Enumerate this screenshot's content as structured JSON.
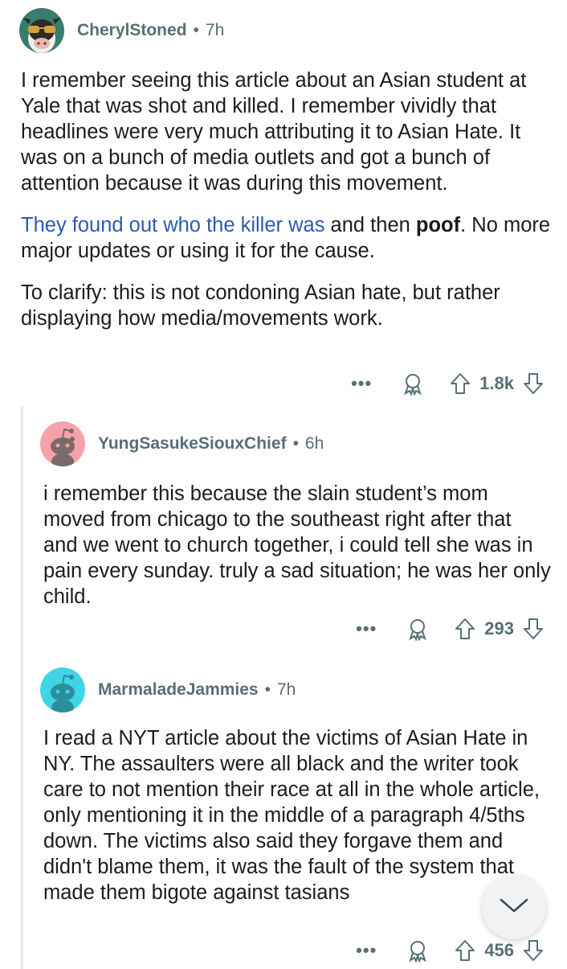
{
  "comments": [
    {
      "username": "CherylStoned",
      "time": "7h",
      "avatar_icon": "cow-sunglasses-avatar",
      "para1": "I remember seeing this article about an Asian student at Yale that was shot and killed. I remember vividly that headlines were very much attributing it to Asian Hate. It was on a bunch of media outlets and got a bunch of attention because it was during this movement.",
      "para2_link": "They found out who the killer was",
      "para2_mid": " and then ",
      "para2_bold": "poof",
      "para2_end": ". No more major updates or using it for the cause.",
      "para3": "To clarify: this is not condoning Asian hate, but rather displaying how media/movements work.",
      "score": "1.8k"
    },
    {
      "username": "YungSasukeSiouxChief",
      "time": "6h",
      "avatar_icon": "snoo-avatar-pink",
      "para1": "i remember this because the slain student’s mom moved from chicago to the southeast right after that and we went to church together, i could tell she was in pain every sunday. truly a sad situation; he was her only child.",
      "score": "293"
    },
    {
      "username": "MarmaladeJammies",
      "time": "7h",
      "avatar_icon": "snoo-avatar-teal",
      "para1": "I read a NYT article about the victims of Asian Hate in NY. The assaulters were all black and the writer took care to not mention their race at all in the whole article, only mentioning it in the middle of a paragraph 4/5ths down. The victims also said they forgave them and didn't blame them, it was the fault of the system that made them bigote against tasians",
      "score": "456"
    }
  ],
  "ui": {
    "separator": "•",
    "more_label": "•••"
  },
  "colors": {
    "link": "#2e5bb0",
    "meta": "#576f76",
    "avatar_pink": "#f7a1ab",
    "avatar_teal": "#3fd4e6"
  }
}
